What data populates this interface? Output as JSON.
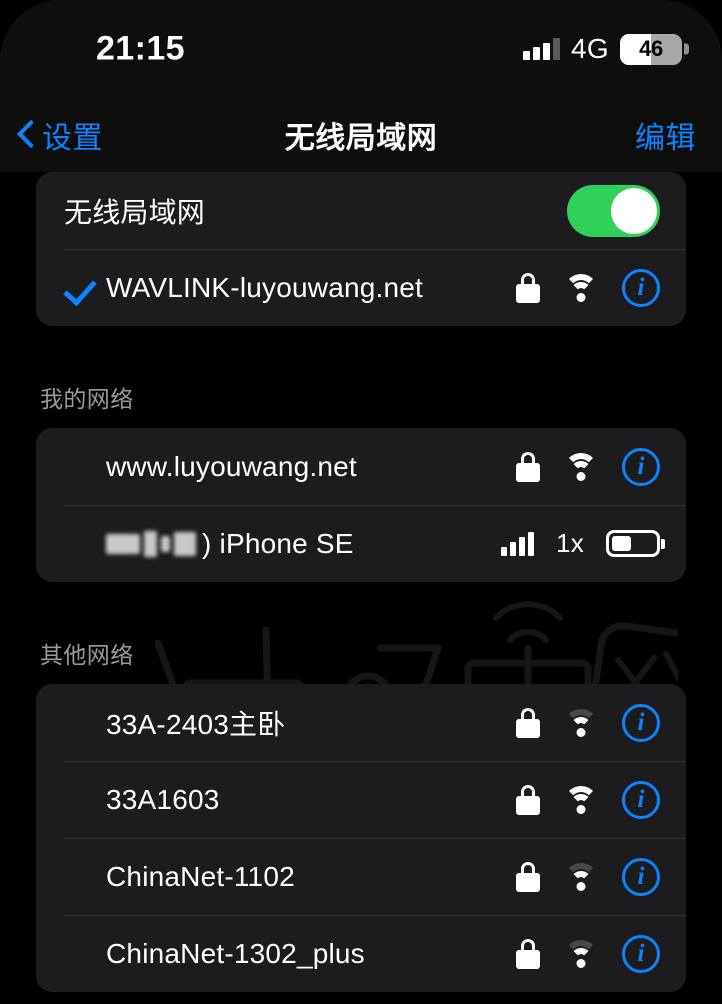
{
  "status_bar": {
    "time": "21:15",
    "network_type": "4G",
    "battery_level": "46",
    "signal_icon": "cellular-signal-icon",
    "battery_icon": "battery-icon"
  },
  "nav_bar": {
    "back_label": "设置",
    "back_icon": "chevron-left-icon",
    "title": "无线局域网",
    "edit_label": "编辑"
  },
  "wifi_toggle_row": {
    "label": "无线局域网",
    "state": "on"
  },
  "connected_network": {
    "name": "WAVLINK-luyouwang.net",
    "connected": true,
    "secured": true,
    "signal_strength": 3
  },
  "my_networks": {
    "header": "我的网络",
    "items": [
      {
        "name": "www.luyouwang.net",
        "type": "wifi",
        "secured": true,
        "signal_strength": 3
      },
      {
        "name": "iPhone SE",
        "type": "hotspot",
        "name_redacted": true,
        "name_prefix": ")",
        "cellular_type": "1x",
        "cellular_bars": 4,
        "battery_fill_percent": 45
      }
    ]
  },
  "other_networks": {
    "header": "其他网络",
    "items": [
      {
        "name": "33A-2403主卧",
        "secured": true,
        "signal_strength": 2
      },
      {
        "name": "33A1603",
        "secured": true,
        "signal_strength": 3
      },
      {
        "name": "ChinaNet-1102",
        "secured": true,
        "signal_strength": 2
      },
      {
        "name": "ChinaNet-1302_plus",
        "secured": true,
        "signal_strength": 2
      }
    ]
  },
  "watermark": {
    "text": "路由网",
    "icon": "router-icon"
  },
  "colors": {
    "accent_blue": "#0a84ff",
    "toggle_green": "#30d158",
    "card_background": "#1c1c1e",
    "page_background": "#000000",
    "header_text": "#9a9a9e"
  }
}
